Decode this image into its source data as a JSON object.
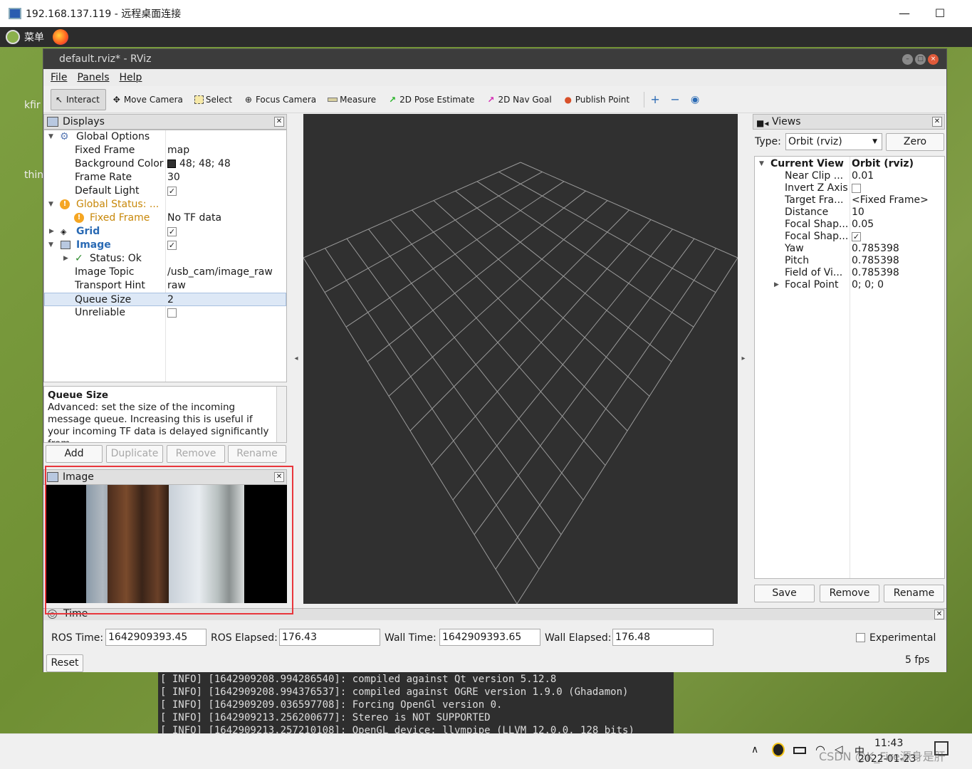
{
  "rdp": {
    "title": "192.168.137.119 - 远程桌面连接",
    "minimize": "—",
    "maximize": "☐"
  },
  "desktop_panel": {
    "menu_label": "菜单"
  },
  "desktop_icons": [
    {
      "label": "kfir"
    },
    {
      "label": "thin"
    }
  ],
  "rviz": {
    "title": "default.rviz* - RViz",
    "menu": [
      "File",
      "Panels",
      "Help"
    ],
    "toolbar": [
      {
        "label": "Interact",
        "icon": "cursor-icon",
        "active": true
      },
      {
        "label": "Move Camera",
        "icon": "move-camera-icon"
      },
      {
        "label": "Select",
        "icon": "select-icon"
      },
      {
        "label": "Focus Camera",
        "icon": "focus-camera-icon"
      },
      {
        "label": "Measure",
        "icon": "ruler-icon"
      },
      {
        "label": "2D Pose Estimate",
        "icon": "green-arrow-icon"
      },
      {
        "label": "2D Nav Goal",
        "icon": "magenta-arrow-icon"
      },
      {
        "label": "Publish Point",
        "icon": "map-pin-icon"
      }
    ],
    "displays": {
      "title": "Displays",
      "rows": [
        {
          "key": "Global Options",
          "value": ""
        },
        {
          "key": "Fixed Frame",
          "value": "map"
        },
        {
          "key": "Background Color",
          "value": "48; 48; 48"
        },
        {
          "key": "Frame Rate",
          "value": "30"
        },
        {
          "key": "Default Light",
          "value": ""
        },
        {
          "key": "Global Status: ...",
          "value": ""
        },
        {
          "key": "Fixed Frame",
          "value": "No TF data"
        },
        {
          "key": "Grid",
          "value": ""
        },
        {
          "key": "Image",
          "value": ""
        },
        {
          "key": "Status: Ok",
          "value": ""
        },
        {
          "key": "Image Topic",
          "value": "/usb_cam/image_raw"
        },
        {
          "key": "Transport Hint",
          "value": "raw"
        },
        {
          "key": "Queue Size",
          "value": "2"
        },
        {
          "key": "Unreliable",
          "value": ""
        }
      ],
      "bg_color": "#303030",
      "description_title": "Queue Size",
      "description_text": "Advanced: set the size of the incoming message queue. Increasing this is useful if your incoming TF data is delayed significantly from",
      "buttons": [
        "Add",
        "Duplicate",
        "Remove",
        "Rename"
      ]
    },
    "image_panel": {
      "title": "Image"
    },
    "views": {
      "title": "Views",
      "type_label": "Type:",
      "type_value": "Orbit (rviz)",
      "zero": "Zero",
      "header_key": "Current View",
      "header_value": "Orbit (rviz)",
      "rows": [
        {
          "key": "Near Clip ...",
          "value": "0.01"
        },
        {
          "key": "Invert Z Axis",
          "value": ""
        },
        {
          "key": "Target Fra...",
          "value": "<Fixed Frame>"
        },
        {
          "key": "Distance",
          "value": "10"
        },
        {
          "key": "Focal Shap...",
          "value": "0.05"
        },
        {
          "key": "Focal Shap...",
          "value": ""
        },
        {
          "key": "Yaw",
          "value": "0.785398"
        },
        {
          "key": "Pitch",
          "value": "0.785398"
        },
        {
          "key": "Field of Vi...",
          "value": "0.785398"
        },
        {
          "key": "Focal Point",
          "value": "0; 0; 0"
        }
      ],
      "buttons": [
        "Save",
        "Remove",
        "Rename"
      ]
    },
    "time": {
      "title": "Time",
      "ros_time_label": "ROS Time:",
      "ros_time": "1642909393.45",
      "ros_elapsed_label": "ROS Elapsed:",
      "ros_elapsed": "176.43",
      "wall_time_label": "Wall Time:",
      "wall_time": "1642909393.65",
      "wall_elapsed_label": "Wall Elapsed:",
      "wall_elapsed": "176.48",
      "experimental": "Experimental",
      "reset": "Reset",
      "fps": "5 fps"
    }
  },
  "terminal": {
    "lines": [
      "[ INFO] [1642909208.994286540]: compiled against Qt version 5.12.8",
      "[ INFO] [1642909208.994376537]: compiled against OGRE version 1.9.0 (Ghadamon)",
      "[ INFO] [1642909209.036597708]: Forcing OpenGl version 0.",
      "[ INFO] [1642909213.256200677]: Stereo is NOT SUPPORTED",
      "[ INFO] [1642909213.257210108]: OpenGL device: llvmpipe (LLVM 12.0.0, 128 bits)"
    ]
  },
  "taskbar": {
    "time": "11:43",
    "date": "2022-01-23",
    "ime": "中",
    "watermark": "CSDN @K_Fire源身是肝"
  }
}
